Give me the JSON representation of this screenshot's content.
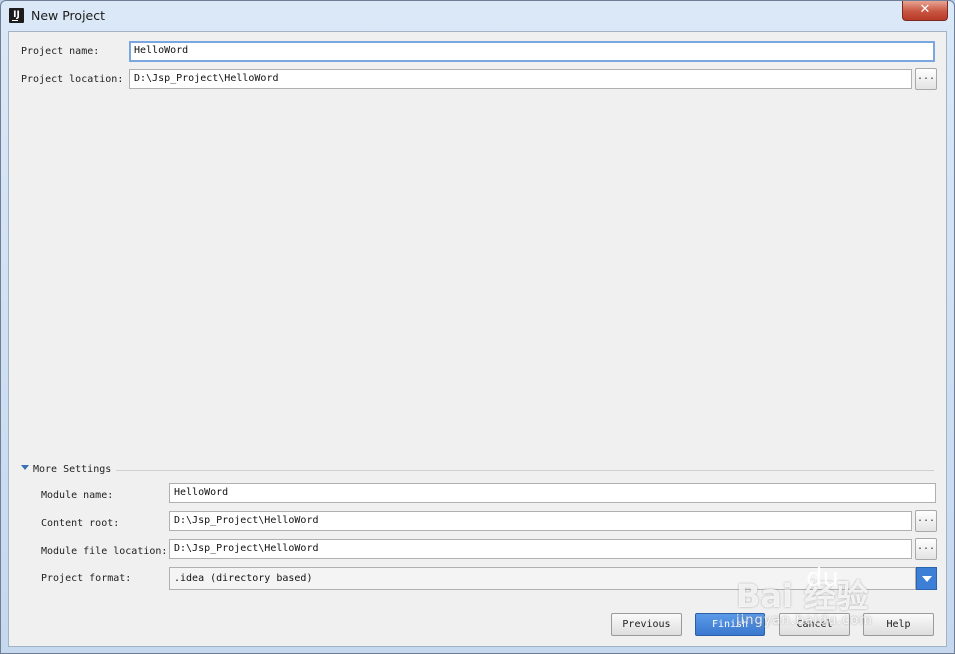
{
  "window": {
    "title": "New Project",
    "app_icon_text": "IJ",
    "close_glyph": "✕"
  },
  "project": {
    "name_label": "Project name:",
    "name_value": "HelloWord",
    "location_label": "Project location:",
    "location_value": "D:\\Jsp_Project\\HelloWord",
    "browse_label": "..."
  },
  "more_settings": {
    "header": "More Settings",
    "expanded": true,
    "module_name_label": "Module name:",
    "module_name_value": "HelloWord",
    "content_root_label": "Content root:",
    "content_root_value": "D:\\Jsp_Project\\HelloWord",
    "module_file_location_label": "Module file location:",
    "module_file_location_value": "D:\\Jsp_Project\\HelloWord",
    "project_format_label": "Project format:",
    "project_format_value": ".idea (directory based)",
    "browse_label": "..."
  },
  "buttons": {
    "previous": "Previous",
    "finish": "Finish",
    "cancel": "Cancel",
    "help": "Help"
  },
  "watermark": {
    "brand": "Bai  经验",
    "paw": "du",
    "url": "jingyan.baidu.com"
  },
  "colors": {
    "accent": "#3d7fd6",
    "dialog_background": "#f0f0f0",
    "close_button": "#c85541"
  }
}
